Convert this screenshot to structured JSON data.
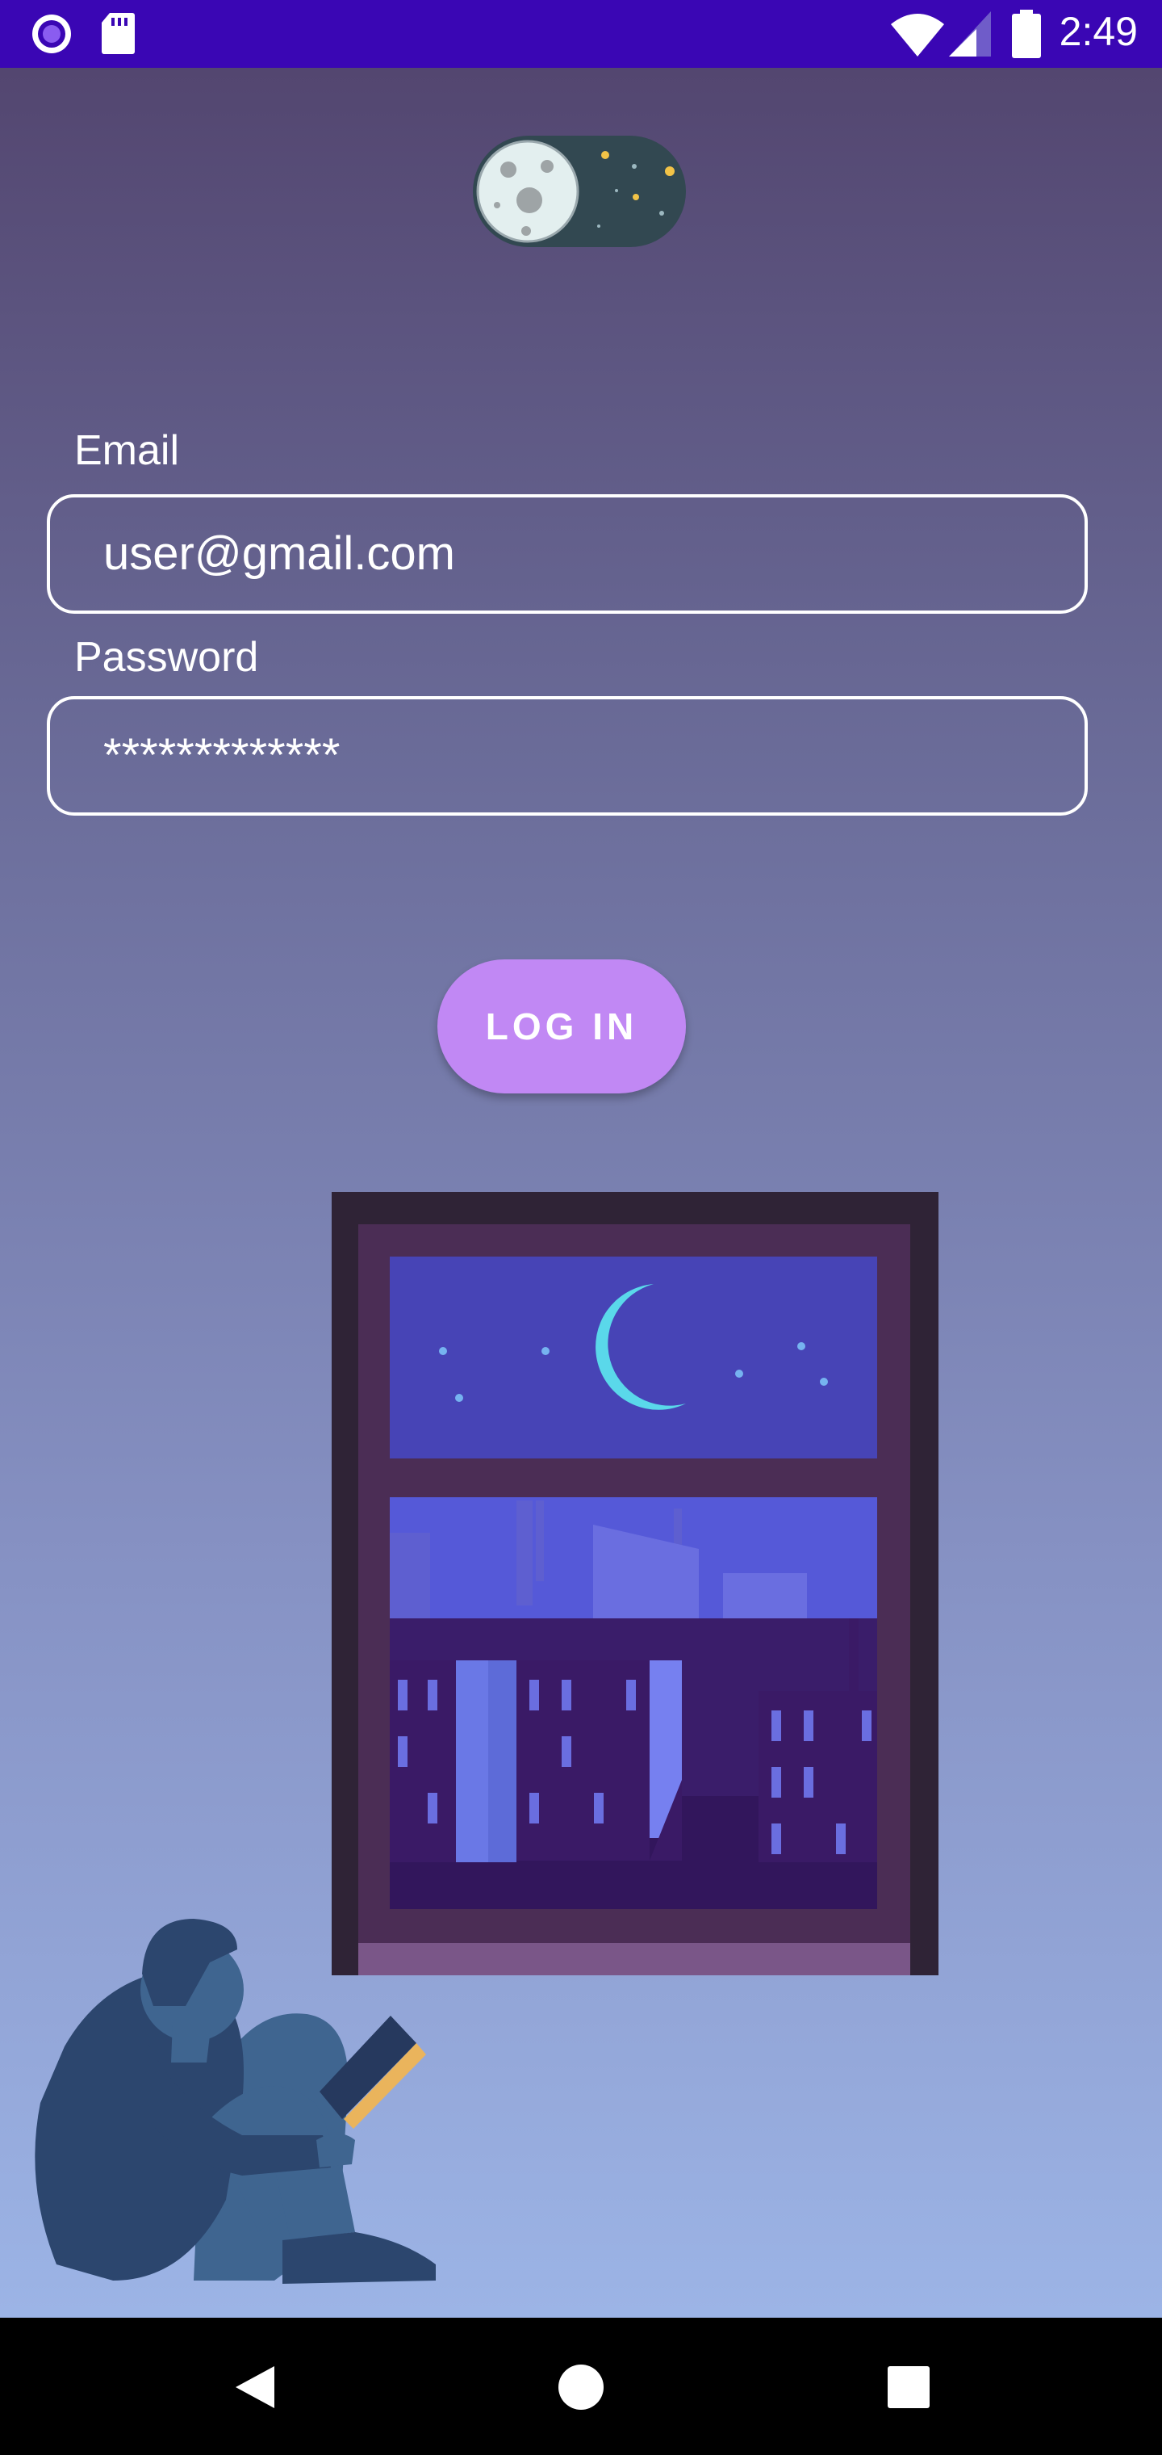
{
  "status_bar": {
    "time": "2:49",
    "background": "#3A06B4",
    "icons": [
      "app-notification-icon",
      "sd-card-icon",
      "wifi-icon",
      "cellular-signal-icon",
      "battery-icon"
    ]
  },
  "theme_toggle": {
    "state": "dark",
    "icon": "moon-icon"
  },
  "form": {
    "email_label": "Email",
    "email_value": "user@gmail.com",
    "password_label": "Password",
    "password_value": "*************"
  },
  "login_button": {
    "label": "LOG IN",
    "color": "#C188F4"
  },
  "nav_bar": {
    "icons": [
      "back-icon",
      "home-icon",
      "recents-icon"
    ]
  }
}
